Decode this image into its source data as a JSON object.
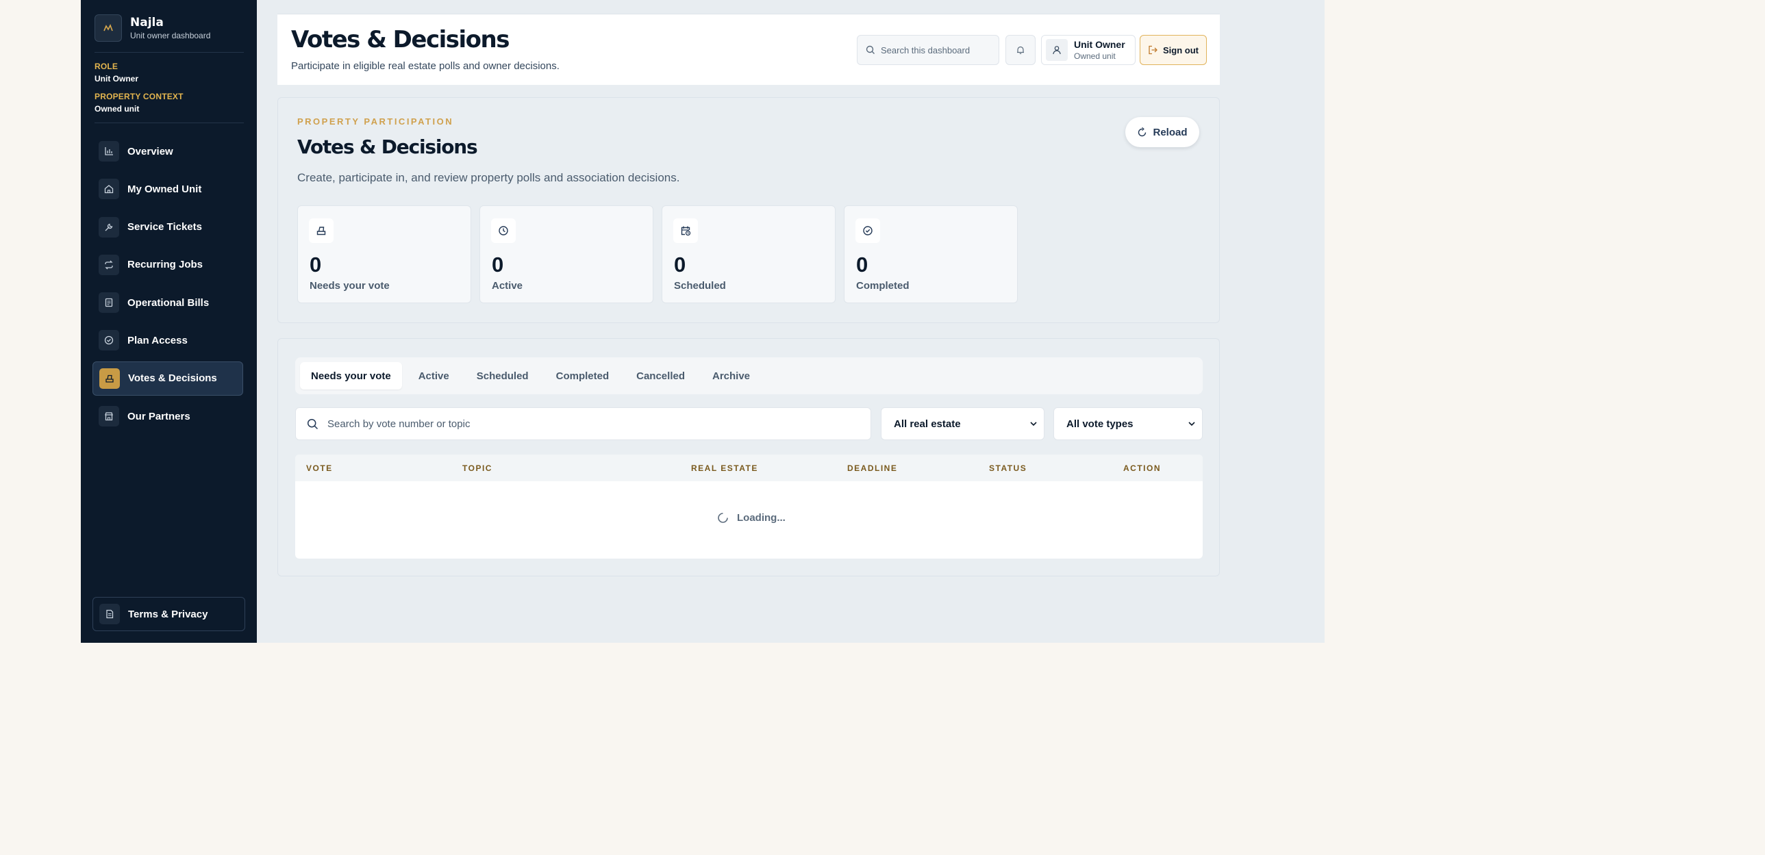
{
  "brand": {
    "name": "Najla",
    "subtitle": "Unit owner dashboard"
  },
  "context": {
    "role_label": "ROLE",
    "role_value": "Unit Owner",
    "property_label": "PROPERTY CONTEXT",
    "property_value": "Owned unit"
  },
  "sidebar": {
    "items": [
      {
        "label": "Overview",
        "icon": "bar-chart-icon",
        "active": false
      },
      {
        "label": "My Owned Unit",
        "icon": "home-icon",
        "active": false
      },
      {
        "label": "Service Tickets",
        "icon": "wrench-icon",
        "active": false
      },
      {
        "label": "Recurring Jobs",
        "icon": "repeat-icon",
        "active": false
      },
      {
        "label": "Operational Bills",
        "icon": "receipt-icon",
        "active": false
      },
      {
        "label": "Plan Access",
        "icon": "check-circle-icon",
        "active": false
      },
      {
        "label": "Votes & Decisions",
        "icon": "ballot-box-icon",
        "active": true
      },
      {
        "label": "Our Partners",
        "icon": "store-icon",
        "active": false
      }
    ],
    "footer": {
      "label": "Terms & Privacy",
      "icon": "document-icon"
    }
  },
  "header": {
    "title": "Votes & Decisions",
    "subtitle": "Participate in eligible real estate polls and owner decisions.",
    "search_placeholder": "Search this dashboard",
    "user_name": "Unit Owner",
    "user_role": "Owned unit",
    "signout_label": "Sign out"
  },
  "hero": {
    "eyebrow": "PROPERTY PARTICIPATION",
    "title": "Votes & Decisions",
    "subtitle": "Create, participate in, and review property polls and association decisions.",
    "reload_label": "Reload",
    "stats": [
      {
        "value": "0",
        "label": "Needs your vote",
        "icon": "ballot-box-icon"
      },
      {
        "value": "0",
        "label": "Active",
        "icon": "clock-icon"
      },
      {
        "value": "0",
        "label": "Scheduled",
        "icon": "calendar-clock-icon"
      },
      {
        "value": "0",
        "label": "Completed",
        "icon": "check-circle-icon"
      }
    ]
  },
  "votes": {
    "tabs": [
      "Needs your vote",
      "Active",
      "Scheduled",
      "Completed",
      "Cancelled",
      "Archive"
    ],
    "active_tab": "Needs your vote",
    "search_placeholder": "Search by vote number or topic",
    "filter_real_estate": "All real estate",
    "filter_vote_types": "All vote types",
    "columns": [
      "VOTE",
      "TOPIC",
      "REAL ESTATE",
      "DEADLINE",
      "STATUS",
      "ACTION"
    ],
    "loading_text": "Loading..."
  },
  "colors": {
    "sidebar_bg": "#0c1a2b",
    "accent_gold": "#c89b45",
    "content_bg": "#e8edf1"
  }
}
